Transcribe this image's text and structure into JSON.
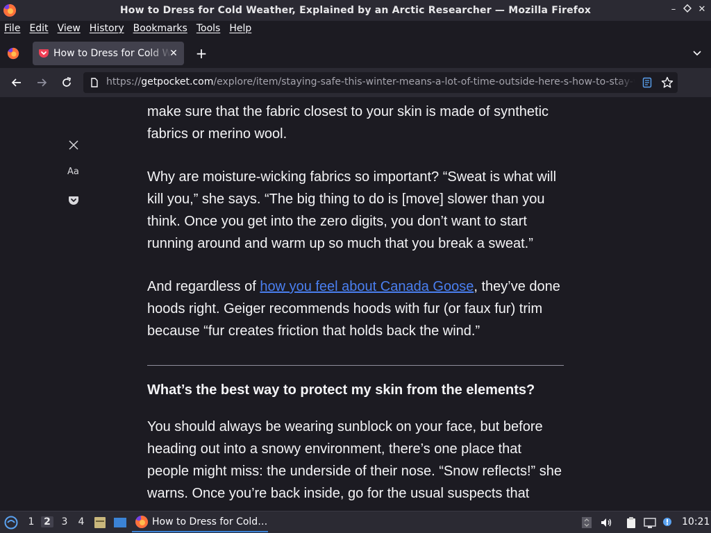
{
  "window": {
    "title": "How to Dress for Cold Weather, Explained by an Arctic Researcher — Mozilla Firefox",
    "controls": [
      "minimize-icon",
      "maximize-icon",
      "close-icon"
    ]
  },
  "menubar": {
    "items": [
      "File",
      "Edit",
      "View",
      "History",
      "Bookmarks",
      "Tools",
      "Help"
    ]
  },
  "tabs": [
    {
      "label": "How to Dress for Cold Weather, Explained by an Arctic Researcher",
      "icon": "pocket-icon",
      "active": true
    }
  ],
  "urlbar": {
    "prefix": "https://",
    "host": "getpocket.com",
    "path": "/explore/item/staying-safe-this-winter-means-a-lot-of-time-outside-here-s-how-to-stay-warm"
  },
  "reader_toolbar": [
    "close-icon",
    "type-controls-icon",
    "pocket-icon"
  ],
  "reader_toolbar_labels": {
    "type": "Aa"
  },
  "article": {
    "p1": "make sure that the fabric closest to your skin is made of synthetic fabrics or merino wool.",
    "p2": "Why are moisture-wicking fabrics so important? “Sweat is what will kill you,” she says. “The big thing to do is [move] slower than you think. Once you get into the zero digits, you don’t want to start running around and warm up so much that you break a sweat.”",
    "p3_before": "And regardless of ",
    "p3_link": "how you feel about Canada Goose",
    "p3_after": ", they’ve done hoods right. Geiger recommends hoods with fur (or faux fur) trim because “fur creates friction that holds back the wind.”",
    "heading": "What’s the best way to protect my skin from the elements?",
    "p4": "You should always be wearing sunblock on your face, but before heading out into a snowy environment, there’s one place that people might miss: the underside of their nose. “Snow reflects!” she warns. Once you’re back inside, go for the usual suspects that"
  },
  "taskbar": {
    "workspaces": [
      "1",
      "2",
      "3",
      "4"
    ],
    "active_workspace": "2",
    "task_label": "How to Dress for Cold…",
    "clock": "10:21"
  },
  "colors": {
    "link": "#4a7ff0",
    "background": "#1c1b22",
    "toolbar": "#2b2a33",
    "active_tab": "#42414d"
  }
}
